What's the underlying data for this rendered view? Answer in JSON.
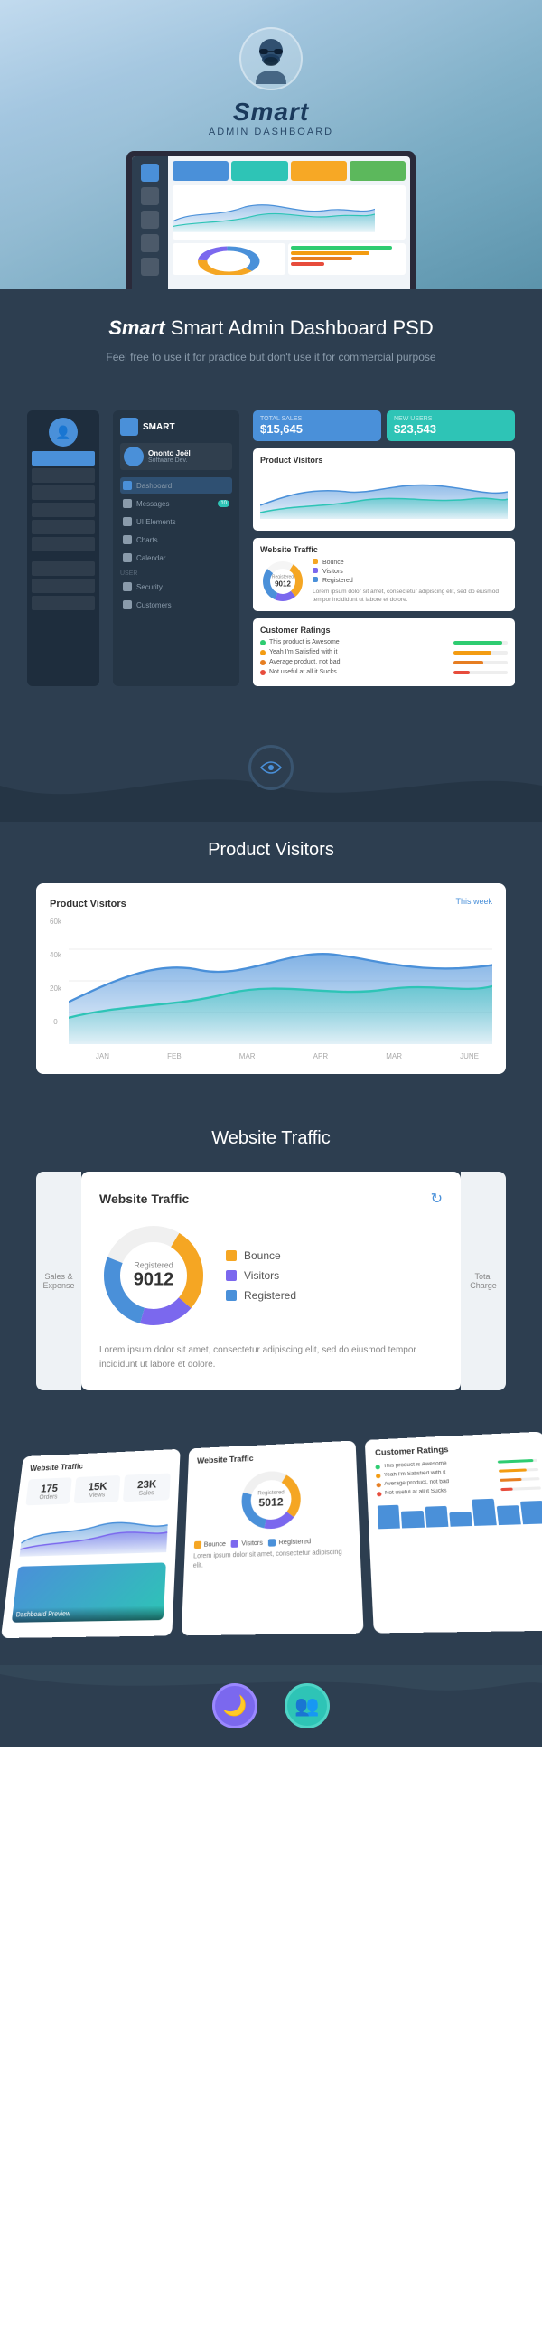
{
  "app": {
    "name": "Smart",
    "subtitle": "ADMIN Dashboard",
    "tagline_title": "Smart Admin Dashboard PSD",
    "tagline_desc": "Feel free to use it for practice but don't use it for commercial purpose"
  },
  "hero": {
    "avatar_emoji": "🧔",
    "brand_italic": "Smart"
  },
  "dashboard_preview": {
    "user_name": "Ononto Joël",
    "user_role": "Software Dev.",
    "menu_items": [
      {
        "label": "Dashboard",
        "active": true
      },
      {
        "label": "Messages",
        "badge": "10"
      },
      {
        "label": "UI Elements"
      },
      {
        "label": "Charts"
      },
      {
        "label": "Calendar"
      }
    ],
    "section_labels": [
      "User",
      "Security",
      "Customers"
    ],
    "stats": [
      {
        "label": "TOTAL SALES",
        "value": "$15,645",
        "color": "blue"
      },
      {
        "label": "NEW USERS",
        "value": "$23,543",
        "color": "teal"
      }
    ],
    "product_visitors_title": "Product Visitors",
    "website_traffic_title": "Website Traffic",
    "traffic_number": "9012",
    "traffic_registered_label": "Registered",
    "traffic_legend": [
      {
        "label": "Bounce",
        "color": "#f5a623"
      },
      {
        "label": "Visitors",
        "color": "#7b68ee"
      },
      {
        "label": "Registered",
        "color": "#4a90d9"
      }
    ],
    "traffic_desc": "Lorem ipsum dolor sit amet, consectetur adipiscing elit, sed do eiusmod tempor incididunt ut labore et dolore.",
    "ratings_title": "Customer Ratings",
    "ratings": [
      {
        "text": "This product is Awesome",
        "color": "#2ecc71",
        "pct": 90
      },
      {
        "text": "Yeah I'm Satisfied with it",
        "color": "#f39c12",
        "pct": 70
      },
      {
        "text": "Average product, not bad",
        "color": "#e67e22",
        "pct": 55
      },
      {
        "text": "Not useful at all it Sucks",
        "color": "#e74c3c",
        "pct": 30
      }
    ]
  },
  "sections": {
    "product_visitors": {
      "title": "Product Visitors",
      "chart_title": "Product Visitors",
      "chart_filter": "This week",
      "y_labels": [
        "60k",
        "40k",
        "20k",
        "0"
      ],
      "x_labels": [
        "JAN",
        "FEB",
        "MAR",
        "APR",
        "MAR",
        "JUNE"
      ]
    },
    "website_traffic": {
      "title": "Website Traffic",
      "card_title": "Website Traffic",
      "number": "9012",
      "registered_label": "Registered",
      "legend": [
        {
          "label": "Bounce",
          "color": "#f5a623"
        },
        {
          "label": "Visitors",
          "color": "#7b68ee"
        },
        {
          "label": "Registered",
          "color": "#4a90d9"
        }
      ],
      "desc": "Lorem ipsum dolor sit amet, consectetur adipiscing elit, sed do eiusmod tempor incididunt ut labore et dolore.",
      "peek_left": "Sales & Expense",
      "peek_right": "Total Charge"
    },
    "tilt": {
      "stats": [
        "175",
        "15K",
        "23K"
      ],
      "stat_labels": [
        "Orders",
        "Views",
        "Sales"
      ],
      "donut_num": "5012",
      "donut_label": "Registered",
      "ratings": [
        {
          "text": "This product is Awesome",
          "color": "#2ecc71",
          "pct": 90
        },
        {
          "text": "Yeah I'm Satisfied with it",
          "color": "#f39c12",
          "pct": 70
        },
        {
          "text": "Average product, not bad",
          "color": "#e67e22",
          "pct": 55
        },
        {
          "text": "Not useful at all it Sucks",
          "color": "#e74c3c",
          "pct": 30
        }
      ]
    }
  },
  "colors": {
    "primary_blue": "#4a90d9",
    "teal": "#2ec4b6",
    "orange": "#f5a623",
    "purple": "#7b68ee",
    "dark_bg": "#2d3e50",
    "success": "#2ecc71",
    "warning": "#f39c12",
    "danger": "#e74c3c"
  }
}
